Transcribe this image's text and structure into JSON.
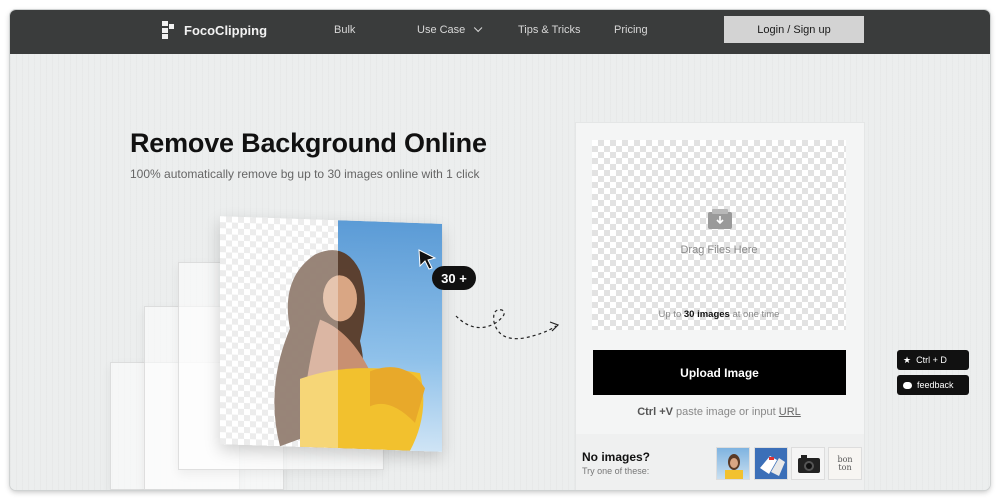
{
  "nav": {
    "logo_text": "FocoClipping",
    "items": [
      "Bulk",
      "Use Case",
      "Tips & Tricks",
      "Pricing"
    ],
    "login_label": "Login / Sign up"
  },
  "hero": {
    "title": "Remove Background Online",
    "subtitle": "100% automatically remove bg up to 30 images online with 1 click",
    "badge": "30 +"
  },
  "upload": {
    "drop_text": "Drag Files Here",
    "limit_prefix": "Up to ",
    "limit_count": "30 images",
    "limit_suffix": " at one time",
    "button_label": "Upload Image",
    "paste_shortcut": "Ctrl +V",
    "paste_text": " paste image or input ",
    "paste_link": "URL"
  },
  "samples": {
    "title": "No images?",
    "subtitle": "Try one of these:",
    "thumbs": [
      "woman-photo",
      "sneakers-photo",
      "camera-photo",
      "bonton-logo"
    ],
    "bonton_text": "bon ton"
  },
  "side": {
    "bookmark_label": "Ctrl + D",
    "feedback_label": "feedback"
  },
  "colors": {
    "nav_bg": "#3a3c3c",
    "upload_bg": "#000000",
    "accent_yellow": "#f2c12e",
    "sky_blue": "#7fb3e0"
  }
}
